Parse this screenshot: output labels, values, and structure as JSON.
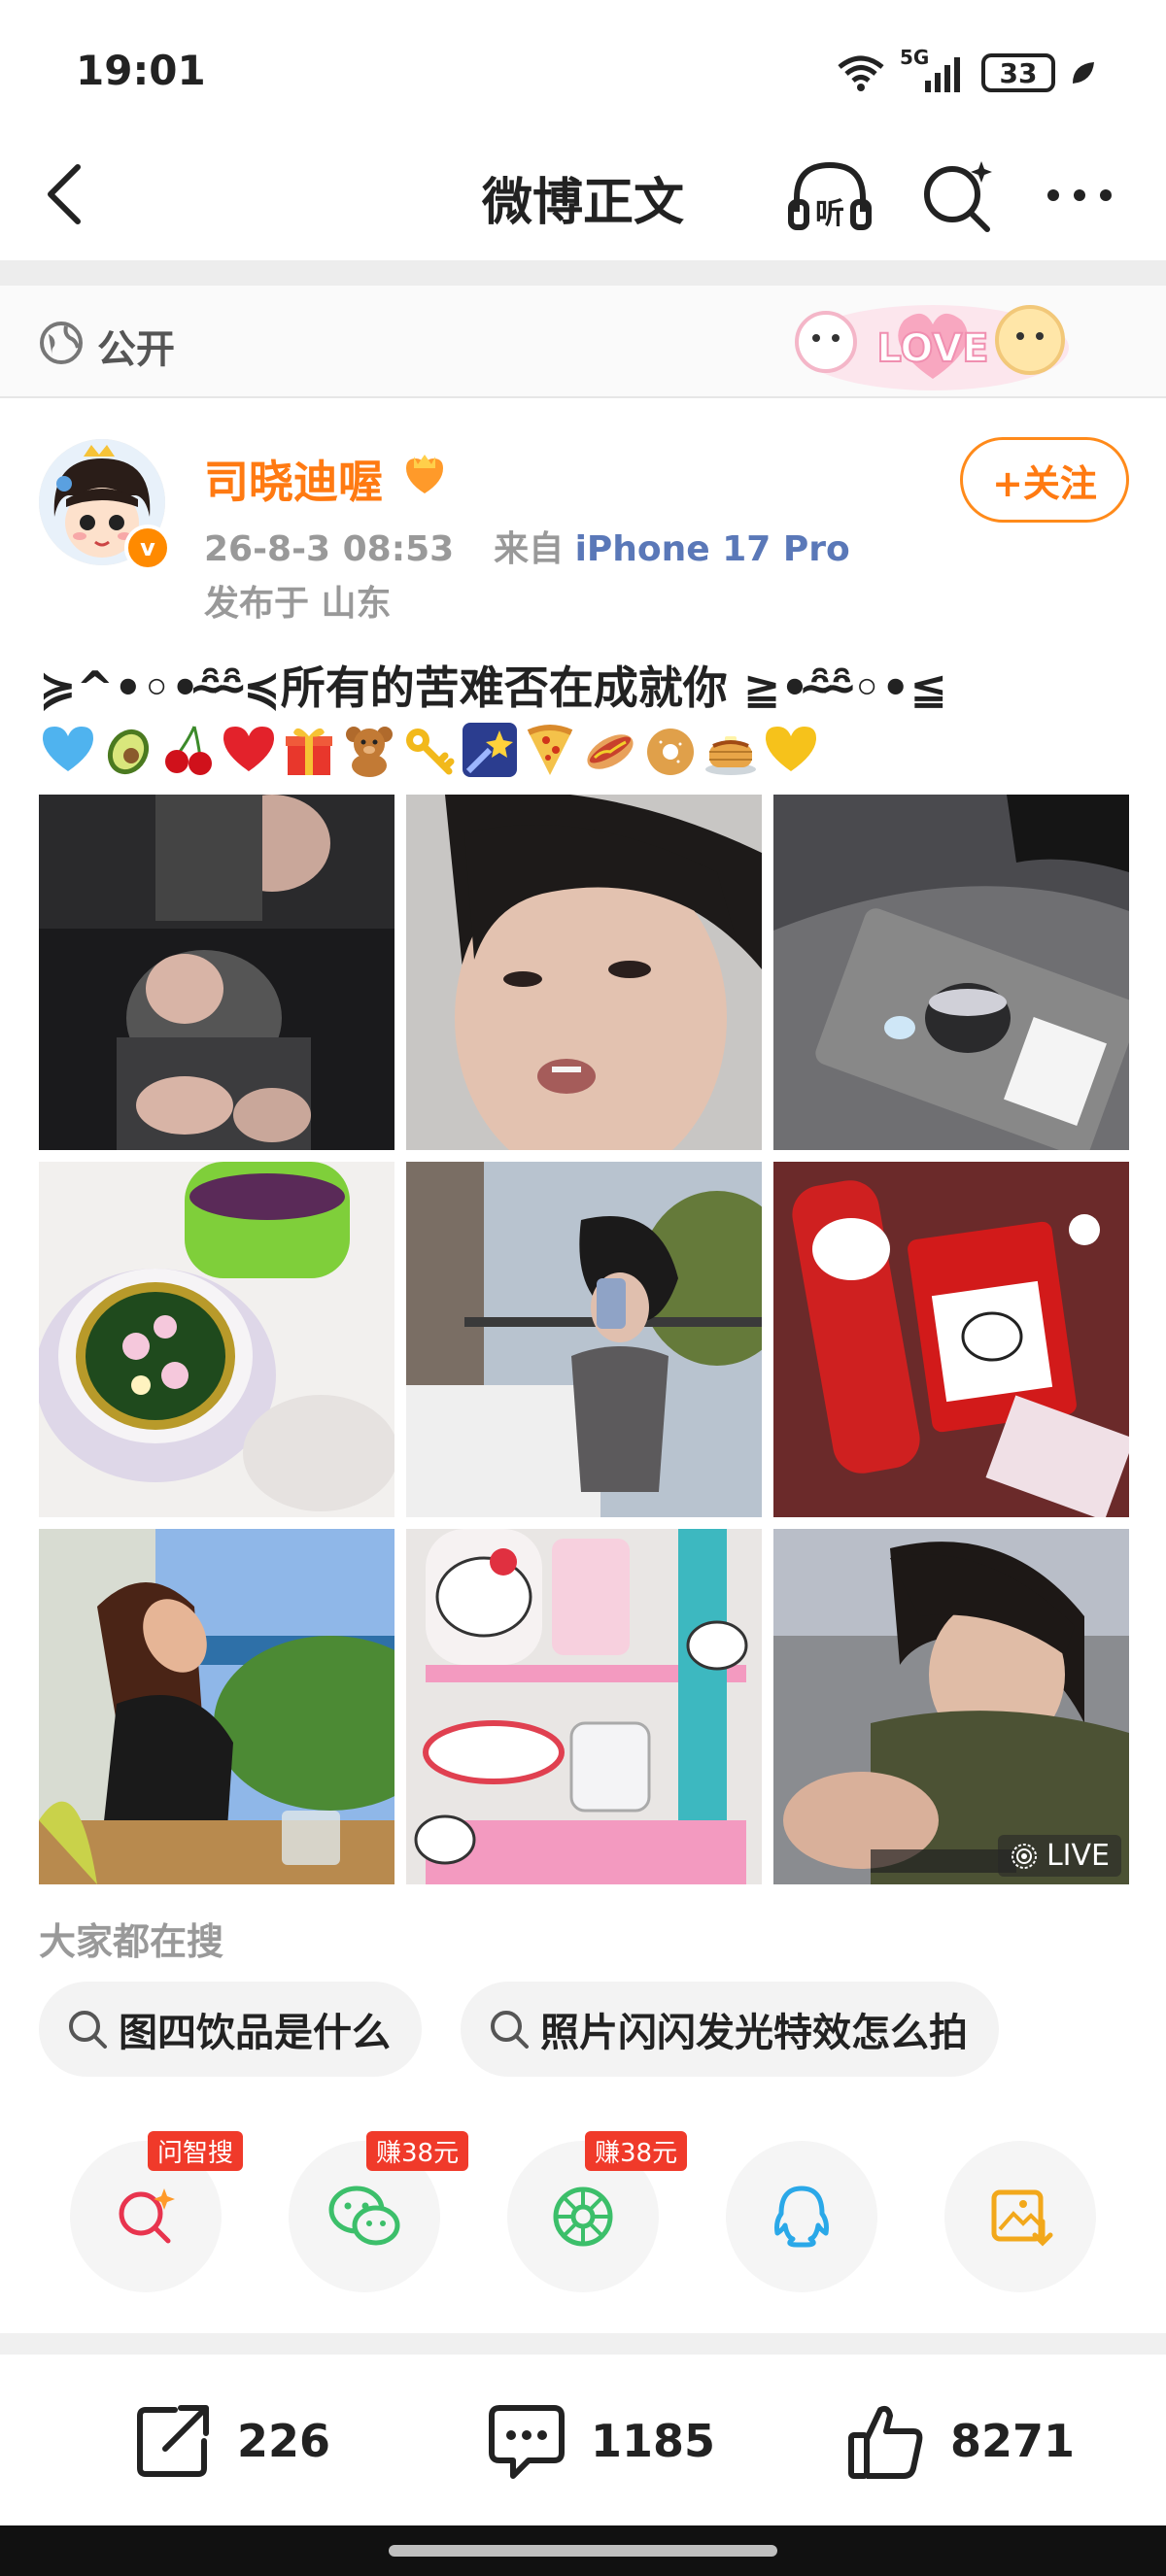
{
  "status_bar": {
    "time": "19:01",
    "network": "5G",
    "battery": "33"
  },
  "nav": {
    "title": "微博正文"
  },
  "visibility": {
    "label": "公开",
    "sticker_text": "LOVE"
  },
  "author": {
    "name": "司晓迪喔",
    "timestamp": "26-8-3 08:53",
    "source_prefix": "来自",
    "source_device": "iPhone 17 Pro",
    "location": "发布于 山东",
    "follow_label": "+关注",
    "verified": "v"
  },
  "post": {
    "text": "≽^•◦•ᵔ̴̑ᵔ̴̑≼所有的苦难否在成就你 ≧•ᵔ̴̑ᵔ̴̑◦•≦",
    "emojis": [
      "blue-heart",
      "avocado",
      "cherries",
      "red-heart",
      "gift",
      "teddy-bear",
      "key",
      "shooting-star",
      "pizza",
      "hotdog",
      "bagel",
      "pancakes",
      "yellow-heart"
    ]
  },
  "photos": {
    "live_label": "LIVE",
    "items": [
      "photo-1",
      "photo-2",
      "photo-3",
      "photo-4",
      "photo-5",
      "photo-6",
      "photo-7",
      "photo-8",
      "photo-9"
    ]
  },
  "hot_search": {
    "title": "大家都在搜",
    "chips": [
      "图四饮品是什么",
      "照片闪闪发光特效怎么拍"
    ]
  },
  "share": {
    "items": [
      {
        "name": "ai-search",
        "badge": "问智搜"
      },
      {
        "name": "wechat",
        "badge": "赚38元"
      },
      {
        "name": "moments",
        "badge": "赚38元"
      },
      {
        "name": "qq",
        "badge": ""
      },
      {
        "name": "save-image",
        "badge": ""
      }
    ]
  },
  "actions": {
    "repost_count": "226",
    "comment_count": "1185",
    "like_count": "8271"
  },
  "colors": {
    "accent": "#ff7a12",
    "link": "#5a78b8",
    "badge_red": "#f03a2a"
  }
}
